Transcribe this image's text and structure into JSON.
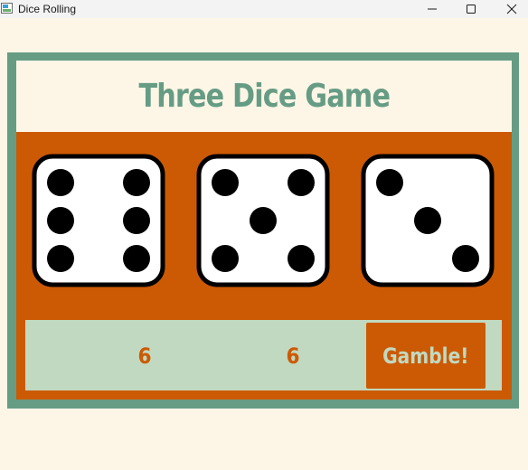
{
  "window": {
    "title": "Dice Rolling"
  },
  "game": {
    "title": "Three Dice Game",
    "dice": [
      {
        "value": 6
      },
      {
        "value": 5
      },
      {
        "value": 3
      }
    ],
    "scores": [
      "6",
      "6"
    ],
    "gamble_label": "Gamble!"
  },
  "colors": {
    "background": "#fdf5e6",
    "frame": "#669c84",
    "panel": "#cc5a04",
    "bottom_panel": "#c1d9c0",
    "die_face": "#ffffff",
    "pip": "#000000"
  },
  "icons": {
    "minimize": "minimize-icon",
    "maximize": "maximize-icon",
    "close": "close-icon"
  }
}
